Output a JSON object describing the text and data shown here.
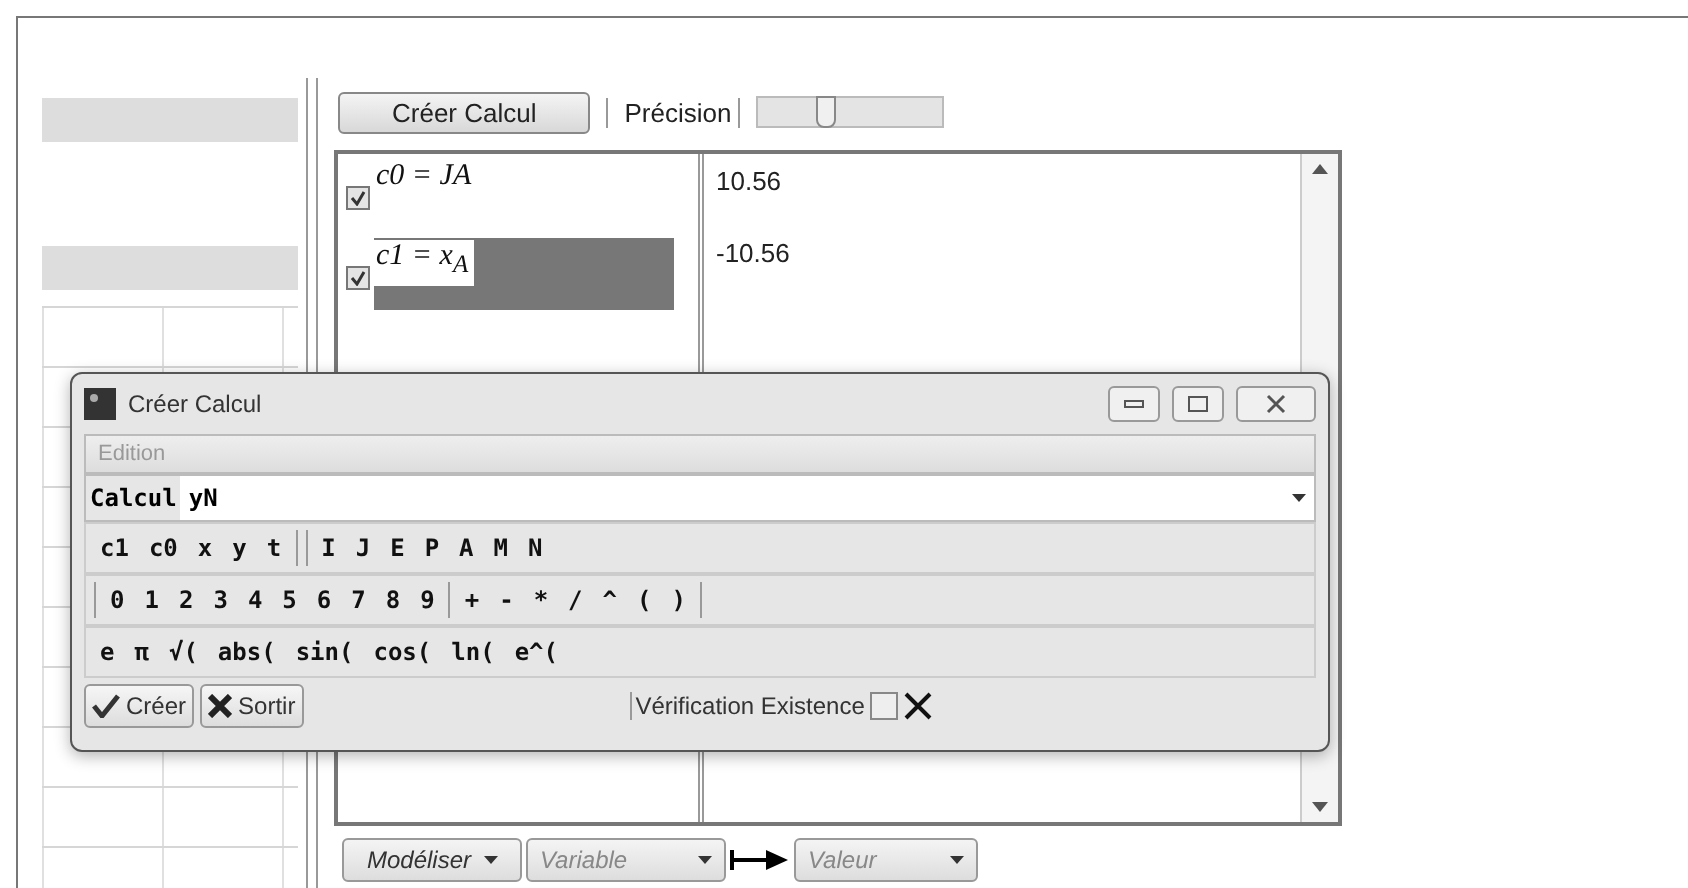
{
  "toolbar": {
    "create_button": "Créer Calcul",
    "precision_label": "Précision",
    "precision_slider": {
      "level": 0.35
    }
  },
  "calculations": [
    {
      "checked": true,
      "selected": false,
      "formula": "c0 = JA",
      "value": "10.56"
    },
    {
      "checked": true,
      "selected": true,
      "formula": "c1 = x$_{A}$",
      "value": "-10.56"
    }
  ],
  "bottom_bar": {
    "model_button": "Modéliser",
    "variable_placeholder": "Variable",
    "value_placeholder": "Valeur"
  },
  "dialog": {
    "title": "Créer Calcul",
    "menu": [
      {
        "label": "Edition",
        "disabled": true
      }
    ],
    "field_label": "Calcul",
    "field_value": "yN",
    "token_rows": [
      [
        {
          "kind": "token",
          "text": "c1"
        },
        {
          "kind": "token",
          "text": "c0"
        },
        {
          "kind": "token",
          "text": "x"
        },
        {
          "kind": "token",
          "text": "y"
        },
        {
          "kind": "token",
          "text": "t"
        },
        {
          "kind": "sep"
        },
        {
          "kind": "sep"
        },
        {
          "kind": "token",
          "text": "I"
        },
        {
          "kind": "token",
          "text": "J"
        },
        {
          "kind": "token",
          "text": "E"
        },
        {
          "kind": "token",
          "text": "P"
        },
        {
          "kind": "token",
          "text": "A"
        },
        {
          "kind": "token",
          "text": "M"
        },
        {
          "kind": "token",
          "text": "N"
        }
      ],
      [
        {
          "kind": "sep"
        },
        {
          "kind": "token",
          "text": "0"
        },
        {
          "kind": "token",
          "text": "1"
        },
        {
          "kind": "token",
          "text": "2"
        },
        {
          "kind": "token",
          "text": "3"
        },
        {
          "kind": "token",
          "text": "4"
        },
        {
          "kind": "token",
          "text": "5"
        },
        {
          "kind": "token",
          "text": "6"
        },
        {
          "kind": "token",
          "text": "7"
        },
        {
          "kind": "token",
          "text": "8"
        },
        {
          "kind": "token",
          "text": "9"
        },
        {
          "kind": "sep"
        },
        {
          "kind": "token",
          "text": "+"
        },
        {
          "kind": "token",
          "text": "-"
        },
        {
          "kind": "token",
          "text": "*"
        },
        {
          "kind": "token",
          "text": "/"
        },
        {
          "kind": "token",
          "text": "^"
        },
        {
          "kind": "token",
          "text": "("
        },
        {
          "kind": "token",
          "text": ")"
        },
        {
          "kind": "sep"
        }
      ],
      [
        {
          "kind": "token",
          "text": "e"
        },
        {
          "kind": "token",
          "text": "π"
        },
        {
          "kind": "token",
          "text": "√("
        },
        {
          "kind": "token",
          "text": "abs("
        },
        {
          "kind": "token",
          "text": "sin("
        },
        {
          "kind": "token",
          "text": "cos("
        },
        {
          "kind": "token",
          "text": "ln("
        },
        {
          "kind": "token",
          "text": "e^("
        }
      ]
    ],
    "buttons": [
      {
        "kind": "ok",
        "label": "Créer"
      },
      {
        "kind": "cancel",
        "label": "Sortir"
      }
    ],
    "check": {
      "label": "Vérification Existence",
      "checked": false
    }
  }
}
